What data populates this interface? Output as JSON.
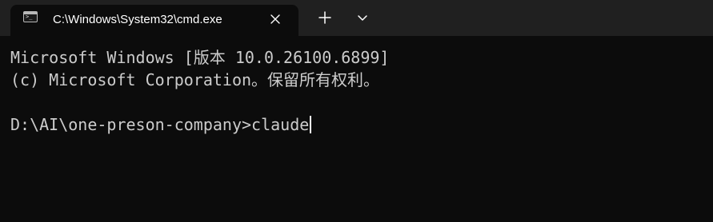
{
  "tab": {
    "title": "C:\\Windows\\System32\\cmd.exe",
    "icon": "terminal-icon",
    "close_icon": "close-icon"
  },
  "tabbar": {
    "new_tab_icon": "plus-icon",
    "dropdown_icon": "chevron-down-icon"
  },
  "terminal": {
    "lines": [
      "Microsoft Windows [版本 10.0.26100.6899]",
      "(c) Microsoft Corporation。保留所有权利。"
    ],
    "prompt": "D:\\AI\\one-preson-company>",
    "command": "claude"
  },
  "colors": {
    "tabbar_background": "#202020",
    "terminal_background": "#0c0c0c",
    "terminal_text": "#cccccc",
    "tab_text": "#ffffff"
  }
}
